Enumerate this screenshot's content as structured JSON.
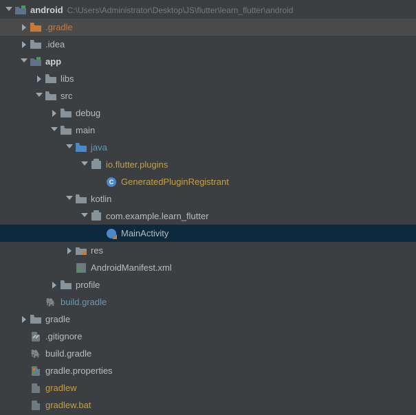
{
  "root": {
    "name": "android",
    "path": "C:\\Users\\Administrator\\Desktop\\JS\\flutter\\learn_flutter\\android"
  },
  "items": [
    {
      "level": 0,
      "arrow": "expanded",
      "icon": "module",
      "label": "android",
      "bold": true,
      "path": "C:\\Users\\Administrator\\Desktop\\JS\\flutter\\learn_flutter\\android",
      "highlighted": false
    },
    {
      "level": 1,
      "arrow": "collapsed",
      "icon": "folder-accent",
      "label": ".gradle",
      "color": "green",
      "highlighted": true
    },
    {
      "level": 1,
      "arrow": "collapsed",
      "icon": "folder",
      "label": ".idea"
    },
    {
      "level": 1,
      "arrow": "expanded",
      "icon": "module",
      "label": "app",
      "bold": true
    },
    {
      "level": 2,
      "arrow": "collapsed",
      "icon": "folder",
      "label": "libs"
    },
    {
      "level": 2,
      "arrow": "expanded",
      "icon": "folder",
      "label": "src"
    },
    {
      "level": 3,
      "arrow": "collapsed",
      "icon": "folder",
      "label": "debug"
    },
    {
      "level": 3,
      "arrow": "expanded",
      "icon": "folder",
      "label": "main"
    },
    {
      "level": 4,
      "arrow": "expanded",
      "icon": "folder-blue",
      "label": "java",
      "color": "changed"
    },
    {
      "level": 5,
      "arrow": "expanded",
      "icon": "package",
      "label": "io.flutter.plugins",
      "color": "yellow"
    },
    {
      "level": 6,
      "arrow": "none",
      "icon": "class",
      "label": "GeneratedPluginRegistrant",
      "color": "yellow"
    },
    {
      "level": 4,
      "arrow": "expanded",
      "icon": "folder",
      "label": "kotlin"
    },
    {
      "level": 5,
      "arrow": "expanded",
      "icon": "package",
      "label": "com.example.learn_flutter"
    },
    {
      "level": 6,
      "arrow": "none",
      "icon": "kotlin",
      "label": "MainActivity",
      "selected": true
    },
    {
      "level": 4,
      "arrow": "collapsed",
      "icon": "folder-res",
      "label": "res"
    },
    {
      "level": 4,
      "arrow": "none",
      "icon": "xml",
      "label": "AndroidManifest.xml"
    },
    {
      "level": 3,
      "arrow": "collapsed",
      "icon": "folder",
      "label": "profile"
    },
    {
      "level": 2,
      "arrow": "none",
      "icon": "gradle",
      "label": "build.gradle",
      "color": "changed"
    },
    {
      "level": 1,
      "arrow": "collapsed",
      "icon": "folder",
      "label": "gradle"
    },
    {
      "level": 1,
      "arrow": "none",
      "icon": "file-git",
      "label": ".gitignore"
    },
    {
      "level": 1,
      "arrow": "none",
      "icon": "gradle",
      "label": "build.gradle"
    },
    {
      "level": 1,
      "arrow": "none",
      "icon": "file-props",
      "label": "gradle.properties"
    },
    {
      "level": 1,
      "arrow": "none",
      "icon": "file",
      "label": "gradlew",
      "color": "yellow"
    },
    {
      "level": 1,
      "arrow": "none",
      "icon": "file",
      "label": "gradlew.bat",
      "color": "yellow"
    }
  ]
}
